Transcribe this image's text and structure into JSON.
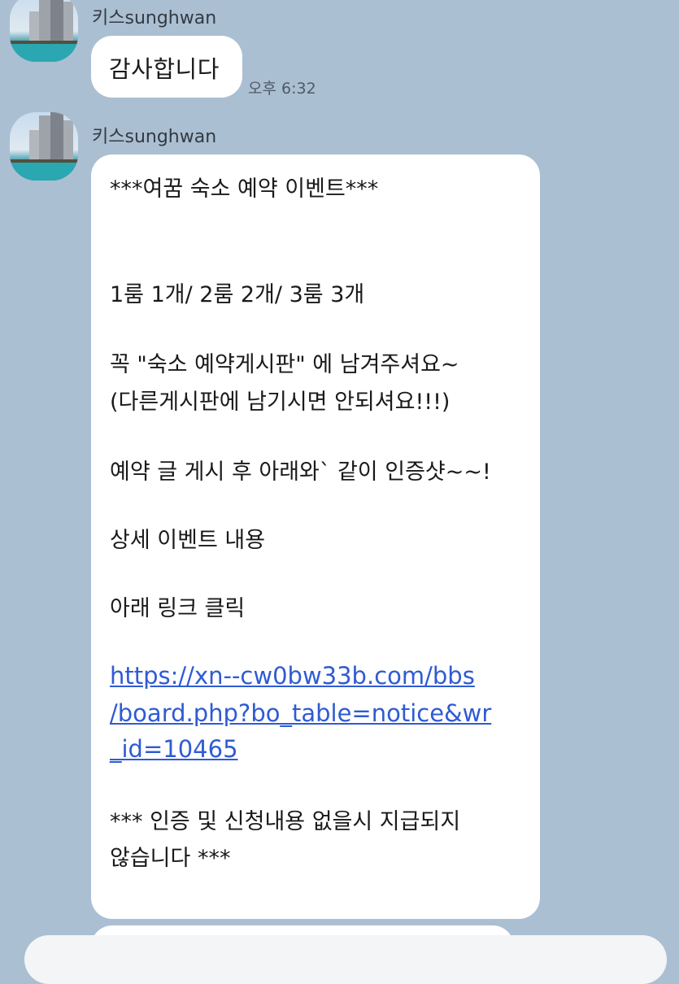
{
  "messages": [
    {
      "sender": "키스sunghwan",
      "text": "감사합니다",
      "time": "오후 6:32"
    },
    {
      "sender": "키스sunghwan",
      "lines": [
        "***여꿈 숙소 예약 이벤트***",
        "1룸 1개/ 2룸 2개/ 3룸 3개",
        "꼭  \"숙소 예약게시판\" 에 남겨주셔요~",
        "(다른게시판에 남기시면 안되셔요!!!)",
        "예약 글 게시 후 아래와` 같이 인증샷~~!",
        "상세 이벤트 내용",
        "아래 링크 클릭",
        "*** 인증 및 신청내용 없을시 지급되지",
        "않습니다 ***"
      ],
      "link_lines": [
        "https://xn--cw0bw33b.com/bbs",
        "/board.php?bo_table=notice&wr",
        "_id=10465"
      ]
    }
  ],
  "colors": {
    "background": "#abbfd3",
    "bubble": "#ffffff",
    "link": "#2f5bd3"
  },
  "icons": {
    "avatar": "avatar-image-pool-buildings"
  }
}
